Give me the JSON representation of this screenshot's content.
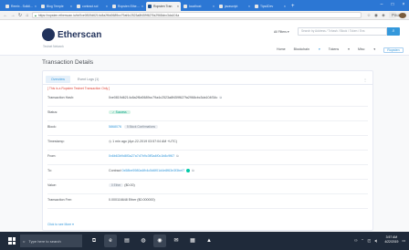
{
  "browser": {
    "tabs": [
      {
        "label": "Remix - Solidity IDE"
      },
      {
        "label": "Blog Temple"
      },
      {
        "label": "contract.sol"
      },
      {
        "label": "Ropsten Etherscan"
      },
      {
        "label": "Ropsten Tran"
      },
      {
        "label": "localhost"
      },
      {
        "label": "javascript"
      },
      {
        "label": "Tips4Dev"
      }
    ],
    "url": "https://ropsten.etherscan.io/tx/0xe0819d6214c8a2f6d0689cc79af4c2523a8f459f627fa2968cbc3da104a",
    "paused_label": "Paused"
  },
  "site": {
    "brand": "Etherscan",
    "network_label": "Testnet Network",
    "filter_label": "All Filters",
    "search_placeholder": "Search by Address / Txhash / Block / Token / Ens",
    "nav": {
      "home": "Home",
      "blockchain": "Blockchain",
      "tokens": "Tokens",
      "misc": "Misc",
      "ropsten": "Ropsten"
    }
  },
  "page": {
    "title": "Transaction Details",
    "tabs": {
      "overview": "Overview",
      "eventlogs": "Event Logs (1)"
    },
    "notice": "[ This is a Ropsten Testnet Transaction Only ]",
    "rows": {
      "hash": {
        "label": "Transaction Hash:",
        "value": "0xe0819d6214c8a2f6d0689cc79a4c2523a8f459f627fa2968cbc3da104f34c"
      },
      "status": {
        "label": "Status:",
        "value": "Success"
      },
      "block": {
        "label": "Block:",
        "value": "5868076",
        "confirmations": "5 Block Confirmations"
      },
      "timestamp": {
        "label": "Timestamp:",
        "value": "1 min ago (Apr-22-2019 03:57:04 AM +UTC)"
      },
      "from": {
        "label": "From:",
        "value": "0x6b63b9d8f3a27a7d7b9c3ff3a4f0c1b8c9f67"
      },
      "to": {
        "label": "To:",
        "prefix": "Contract",
        "value": "0x58be5980a4fb4c5d6f01d4e8f63e3f3bef7"
      },
      "value": {
        "label": "Value:",
        "value": "0 Ether",
        "usd": "($0.00)"
      },
      "fee": {
        "label": "Transaction Fee:",
        "value": "0.000116648 Ether ($0.000000)"
      }
    },
    "see_more": "Click to see More"
  },
  "taskbar": {
    "search_placeholder": "Type here to search",
    "time": "3:57 AM",
    "date": "4/22/2019"
  },
  "colors": {
    "tab_strip": "#2c77d4",
    "brand": "#21325b",
    "link": "#3498db",
    "success": "#00a186",
    "taskbar": "#1f2a3a"
  }
}
